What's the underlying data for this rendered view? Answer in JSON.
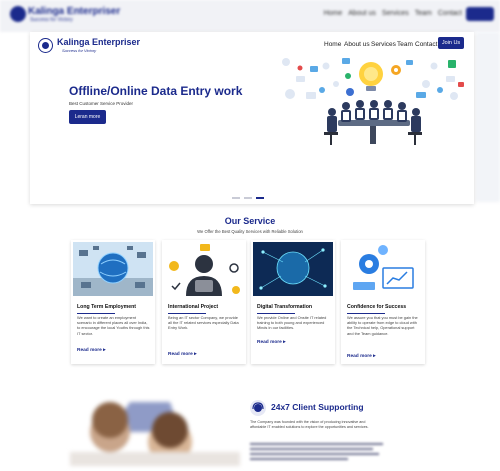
{
  "brand": {
    "name": "Kalinga Enterpriser",
    "tagline": "Success for Victory"
  },
  "nav": {
    "items": [
      "Home",
      "About us",
      "Services",
      "Team",
      "Contact"
    ],
    "join_label": "Join Us"
  },
  "hero": {
    "title": "Offline/Online Data Entry work",
    "subtitle": "Best Customer Service Provider",
    "button_label": "Leran more",
    "slide_index": 3,
    "slide_count": 3
  },
  "services": {
    "title": "Our Service",
    "subtitle": "We Offer the Best Quality Services with Reliable Solution",
    "cards": [
      {
        "heading": "Long Term Employment",
        "text": "We want to create an employment scenario in different places all over India, to encourage the local Youths through this IT sector.",
        "link": "Read more"
      },
      {
        "heading": "International Project",
        "text": "Being an IT sector Company, we provide all the IT related services especially Data Entry Work.",
        "link": "Read more"
      },
      {
        "heading": "Digital Transformation",
        "text": "We provide Online and Onsite IT related training to both young and experienced Minds in our facilities.",
        "link": "Read more"
      },
      {
        "heading": "Confidence for Success",
        "text": "We assure you that you must be gain the ability to operate from edge to cloud with the Technical help, Operational support and the Team guidance.",
        "link": "Read more"
      }
    ]
  },
  "support": {
    "title": "24x7 Client Supporting",
    "text": "The Company was founded with the vision of producing innovative and affordable IT enabled solutions to explore the opportunities and services."
  },
  "colors": {
    "primary": "#1b2a8c",
    "background": "#ffffff"
  }
}
